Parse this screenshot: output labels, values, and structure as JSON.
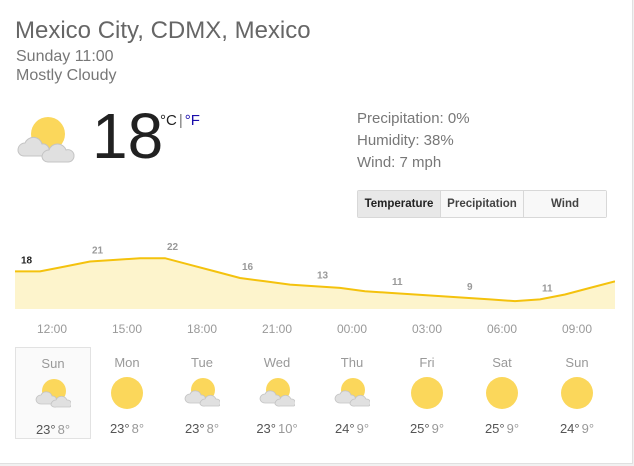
{
  "location": "Mexico City, CDMX, Mexico",
  "datetime": "Sunday 11:00",
  "condition": "Mostly Cloudy",
  "current": {
    "temp": "18",
    "unit_c": "°C",
    "unit_sep": "|",
    "unit_f": "°F",
    "icon": "partly-cloudy-icon"
  },
  "details": {
    "precipitation": "Precipitation: 0%",
    "humidity": "Humidity: 38%",
    "wind": "Wind: 7 mph"
  },
  "tabs": [
    "Temperature",
    "Precipitation",
    "Wind"
  ],
  "selected_tab": "Temperature",
  "colors": {
    "line": "#f4c20d",
    "fill": "#fdf4cc",
    "sun": "#fbd75b"
  },
  "chart_data": {
    "type": "area",
    "x": [
      "11:00",
      "12:00",
      "13:00",
      "14:00",
      "15:00",
      "16:00",
      "17:00",
      "18:00",
      "19:00",
      "20:00",
      "21:00",
      "22:00",
      "23:00",
      "00:00",
      "01:00",
      "02:00",
      "03:00",
      "04:00",
      "05:00",
      "06:00",
      "07:00",
      "08:00",
      "09:00",
      "10:00",
      "11:00"
    ],
    "values": [
      18,
      18,
      19.5,
      21,
      21.5,
      22,
      22,
      20,
      18,
      16,
      15,
      14,
      13.5,
      13,
      12,
      11.5,
      11,
      10.5,
      10,
      9.5,
      9,
      9.5,
      11,
      13,
      15
    ],
    "labels": [
      {
        "x": "11:00",
        "value": "18"
      },
      {
        "x": "14:00",
        "value": "21"
      },
      {
        "x": "17:00",
        "value": "22"
      },
      {
        "x": "20:00",
        "value": "16"
      },
      {
        "x": "23:00",
        "value": "13"
      },
      {
        "x": "02:00",
        "value": "11"
      },
      {
        "x": "05:00",
        "value": "9"
      },
      {
        "x": "08:00",
        "value": "11"
      }
    ],
    "ticks": [
      "12:00",
      "15:00",
      "18:00",
      "21:00",
      "00:00",
      "03:00",
      "06:00",
      "09:00"
    ]
  },
  "forecast": [
    {
      "day": "Sun",
      "hi": "23°",
      "lo": "8°",
      "icon": "partly-cloudy-icon"
    },
    {
      "day": "Mon",
      "hi": "23°",
      "lo": "8°",
      "icon": "sunny-icon"
    },
    {
      "day": "Tue",
      "hi": "23°",
      "lo": "8°",
      "icon": "partly-cloudy-icon"
    },
    {
      "day": "Wed",
      "hi": "23°",
      "lo": "10°",
      "icon": "partly-cloudy-icon"
    },
    {
      "day": "Thu",
      "hi": "24°",
      "lo": "9°",
      "icon": "partly-cloudy-icon"
    },
    {
      "day": "Fri",
      "hi": "25°",
      "lo": "9°",
      "icon": "sunny-icon"
    },
    {
      "day": "Sat",
      "hi": "25°",
      "lo": "9°",
      "icon": "sunny-icon"
    },
    {
      "day": "Sun",
      "hi": "24°",
      "lo": "9°",
      "icon": "sunny-icon"
    }
  ]
}
